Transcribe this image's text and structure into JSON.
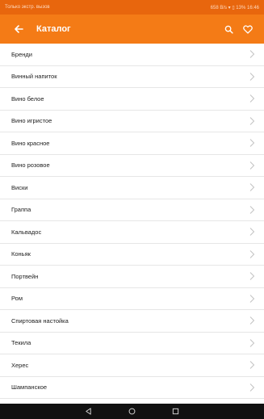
{
  "status_bar": {
    "left_text": "Только экстр. вызов",
    "right_text": "658 B/s ▾ ▯ 13% 16:46"
  },
  "app_bar": {
    "title": "Каталог",
    "back_icon": "arrow-left-icon",
    "search_icon": "search-icon",
    "favorite_icon": "heart-icon"
  },
  "catalog": {
    "items": [
      "Бренди",
      "Винный напиток",
      "Вино белое",
      "Вино игристое",
      "Вино красное",
      "Вино розовое",
      "Виски",
      "Граппа",
      "Кальвадос",
      "Коньяк",
      "Портвейн",
      "Ром",
      "Спиртовая настойка",
      "Текила",
      "Херес",
      "Шампанское"
    ]
  },
  "colors": {
    "app_bar": "#f47b16",
    "status_bar": "#e8660d",
    "nav_bar": "#111111"
  }
}
